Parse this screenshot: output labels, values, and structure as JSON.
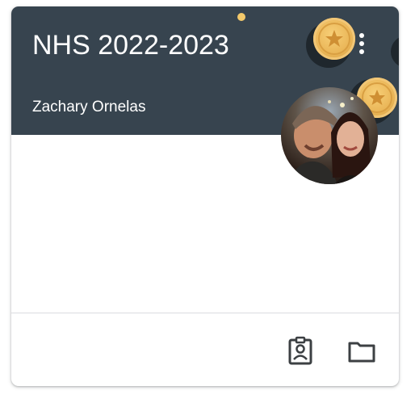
{
  "card": {
    "title": "NHS 2022-2023",
    "teacher": "Zachary Ornelas"
  },
  "colors": {
    "header_bg": "#37444f",
    "coin_gold": "#eab658",
    "icon": "#3c4043"
  },
  "icons": {
    "more": "more-vert-icon",
    "work": "assignment-ind-icon",
    "folder": "folder-icon"
  }
}
